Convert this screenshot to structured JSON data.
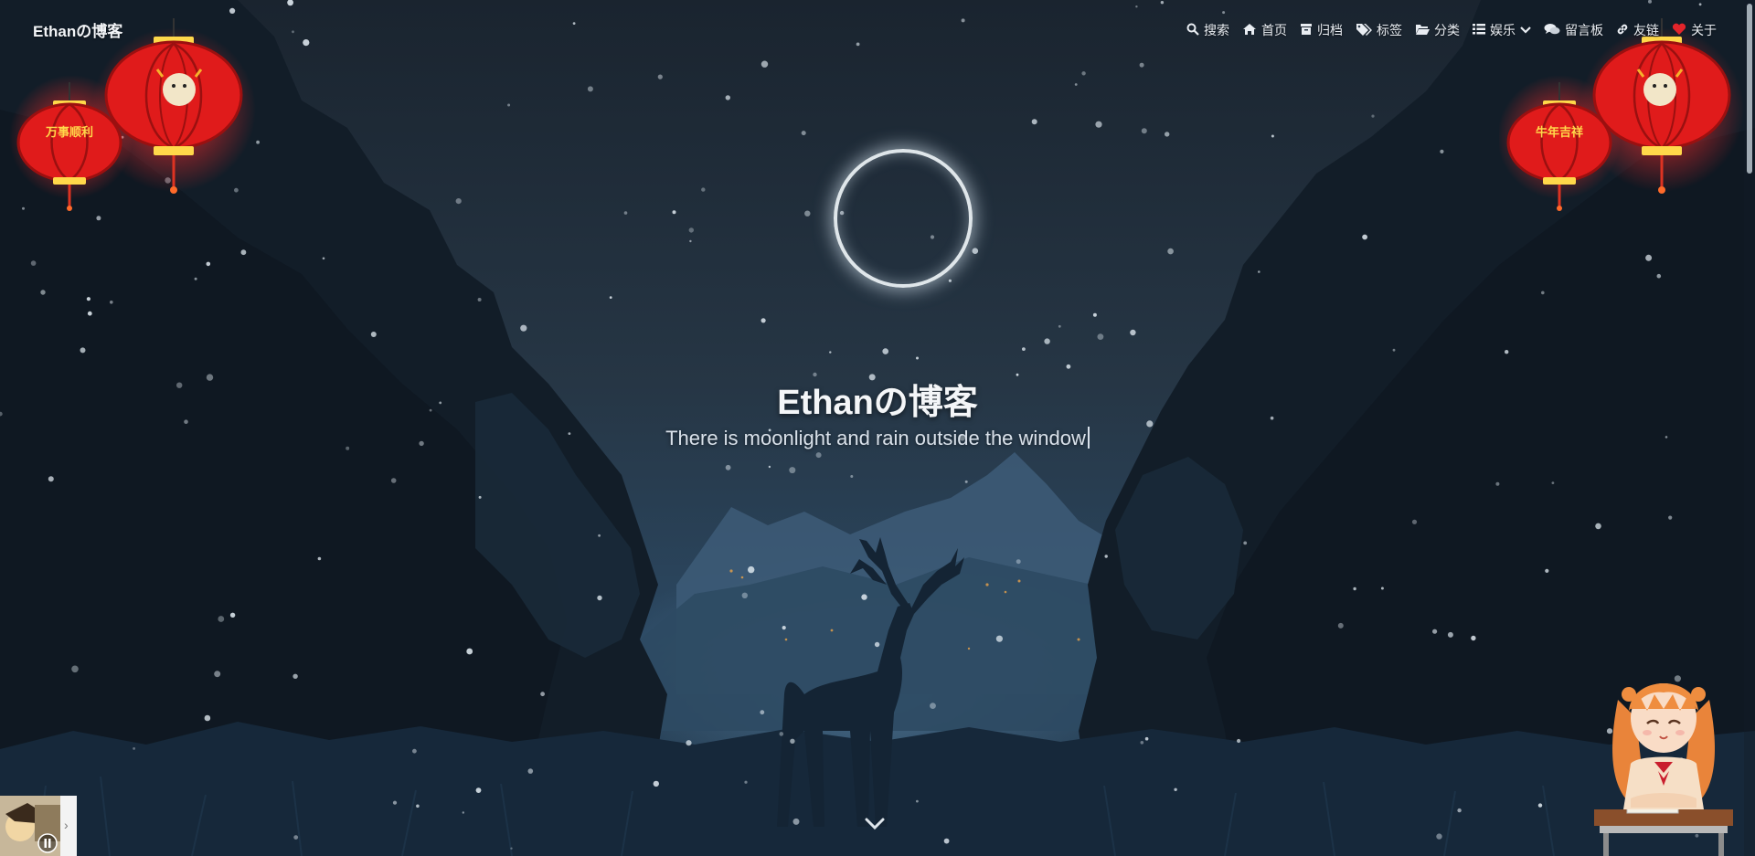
{
  "site": {
    "brand": "Ethanの博客"
  },
  "nav": {
    "items": [
      {
        "key": "search",
        "label": "搜索",
        "icon": "search-icon"
      },
      {
        "key": "home",
        "label": "首页",
        "icon": "home-icon"
      },
      {
        "key": "archive",
        "label": "归档",
        "icon": "archive-icon"
      },
      {
        "key": "tags",
        "label": "标签",
        "icon": "tags-icon"
      },
      {
        "key": "categories",
        "label": "分类",
        "icon": "folder-icon"
      },
      {
        "key": "entertainment",
        "label": "娱乐",
        "icon": "list-icon"
      },
      {
        "key": "guestbook",
        "label": "留言板",
        "icon": "comments-icon"
      },
      {
        "key": "links",
        "label": "友链",
        "icon": "link-icon"
      },
      {
        "key": "about",
        "label": "关于",
        "icon": "heart-icon"
      }
    ]
  },
  "hero": {
    "title": "Ethanの博客",
    "subtitle": "There is moonlight and rain outside the window"
  },
  "lanterns": {
    "left_text": "万事顺利",
    "right_text": "牛年吉祥"
  },
  "colors": {
    "lantern_red": "#e01b1b",
    "lantern_glow": "#ff2a2a",
    "lantern_gold": "#ffd84a",
    "sky_top": "#1c2733",
    "sky_bottom": "#2d4a63"
  }
}
